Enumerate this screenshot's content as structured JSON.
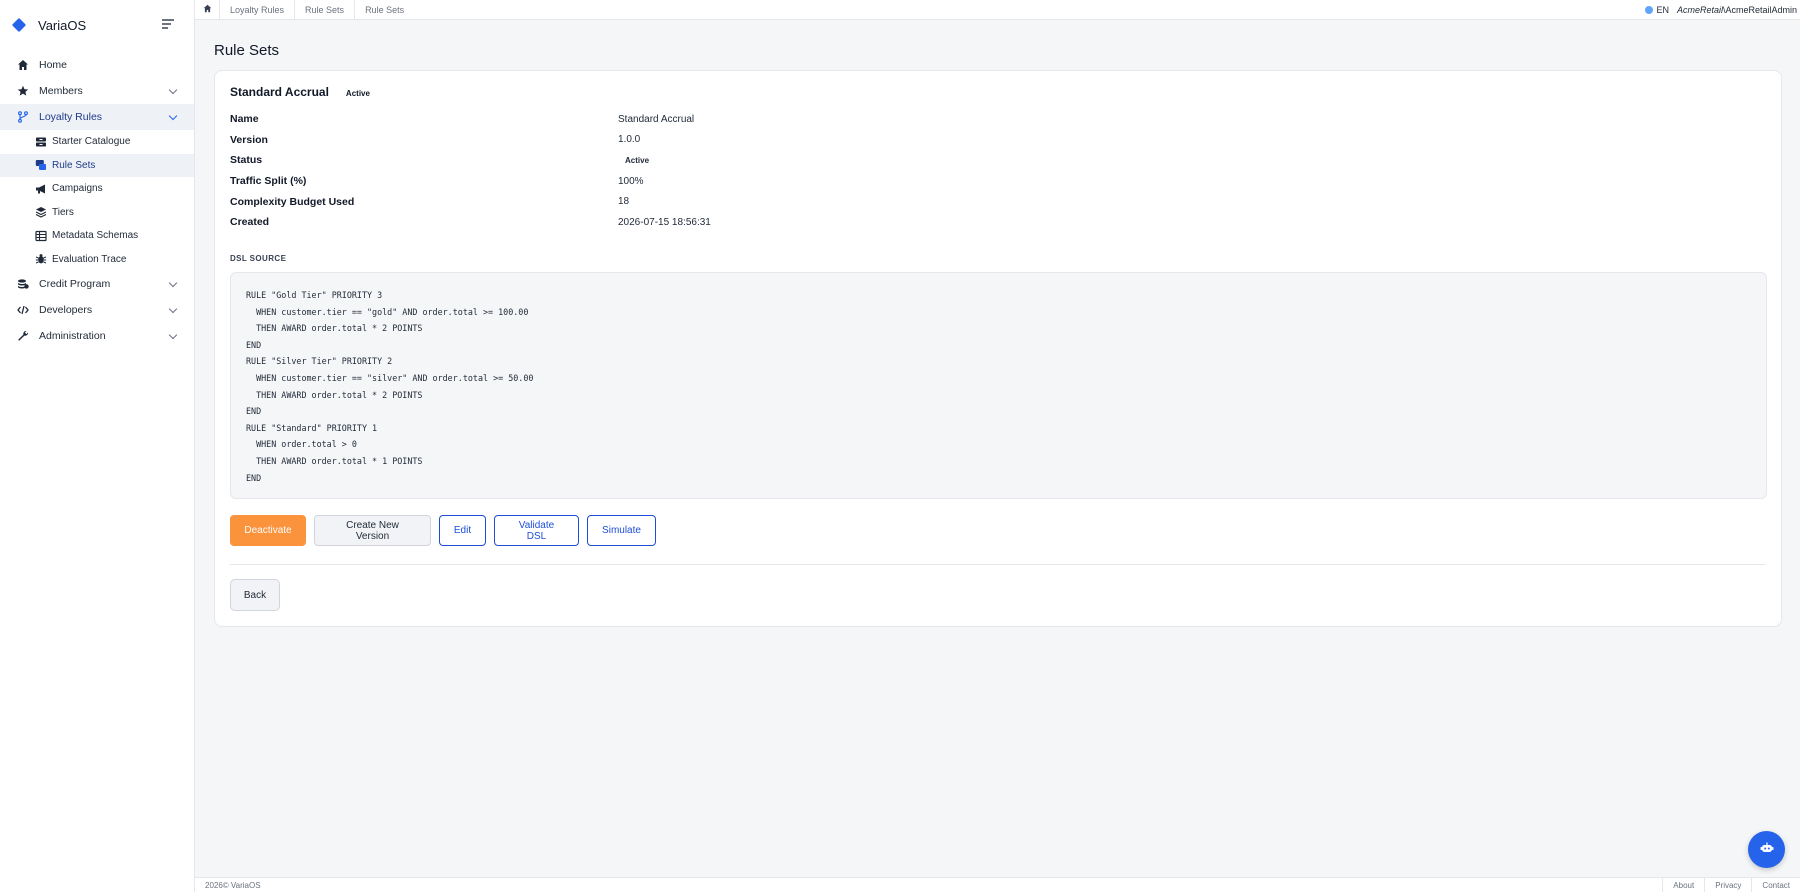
{
  "app": {
    "name": "VariaOS"
  },
  "topbar": {
    "breadcrumbs": [
      "Loyalty Rules",
      "Rule Sets",
      "Rule Sets"
    ],
    "lang": "EN",
    "user_italic": "AcmeRetail",
    "user_rest": "\\AcmeRetailAdmin"
  },
  "sidebar": {
    "items": [
      {
        "label": "Home",
        "icon": "home-icon"
      },
      {
        "label": "Members",
        "icon": "star-icon"
      },
      {
        "label": "Loyalty Rules",
        "icon": "branch-icon"
      },
      {
        "label": "Credit Program",
        "icon": "coins-icon"
      },
      {
        "label": "Developers",
        "icon": "code-icon"
      },
      {
        "label": "Administration",
        "icon": "wrench-icon"
      }
    ],
    "sub_items": [
      {
        "label": "Starter Catalogue",
        "icon": "drawer-icon"
      },
      {
        "label": "Rule Sets",
        "icon": "rule-sets-icon"
      },
      {
        "label": "Campaigns",
        "icon": "megaphone-icon"
      },
      {
        "label": "Tiers",
        "icon": "layers-icon"
      },
      {
        "label": "Metadata Schemas",
        "icon": "table-icon"
      },
      {
        "label": "Evaluation Trace",
        "icon": "bug-icon"
      }
    ]
  },
  "page": {
    "title": "Rule Sets"
  },
  "ruleset": {
    "title": "Standard Accrual",
    "status_badge": "Active",
    "fields": [
      {
        "label": "Name",
        "value": "Standard Accrual"
      },
      {
        "label": "Version",
        "value": "1.0.0"
      },
      {
        "label": "Status",
        "value": "Active"
      },
      {
        "label": "Traffic Split (%)",
        "value": "100%"
      },
      {
        "label": "Complexity Budget Used",
        "value": "18"
      },
      {
        "label": "Created",
        "value": "2026-07-15 18:56:31"
      }
    ],
    "dsl_label": "DSL SOURCE",
    "dsl_lines": [
      "RULE \"Gold Tier\" PRIORITY 3",
      "  WHEN customer.tier == \"gold\" AND order.total >= 100.00",
      "  THEN AWARD order.total * 2 POINTS",
      "END",
      "RULE \"Silver Tier\" PRIORITY 2",
      "  WHEN customer.tier == \"silver\" AND order.total >= 50.00",
      "  THEN AWARD order.total * 2 POINTS",
      "END",
      "RULE \"Standard\" PRIORITY 1",
      "  WHEN order.total > 0",
      "  THEN AWARD order.total * 1 POINTS",
      "END"
    ]
  },
  "actions": {
    "deactivate": "Deactivate",
    "create_version": "Create New Version",
    "edit": "Edit",
    "validate": "Validate DSL",
    "simulate": "Simulate",
    "back": "Back"
  },
  "footer": {
    "copyright": "2026© VariaOS",
    "links": [
      "About",
      "Privacy",
      "Contact"
    ]
  },
  "colors": {
    "accent": "#2563eb",
    "primary_button": "#fb923c"
  }
}
